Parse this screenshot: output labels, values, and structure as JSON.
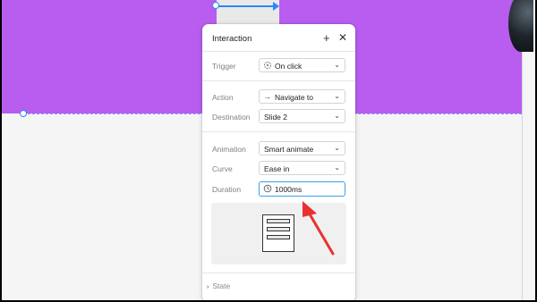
{
  "panel": {
    "title": "Interaction",
    "add_icon": "+",
    "close_icon": "✕"
  },
  "trigger": {
    "label": "Trigger",
    "value": "On click",
    "icon": "tap-icon"
  },
  "action": {
    "label": "Action",
    "value": "Navigate to",
    "icon": "arrow-right-icon"
  },
  "destination": {
    "label": "Destination",
    "value": "Slide 2"
  },
  "animation": {
    "label": "Animation",
    "value": "Smart animate"
  },
  "curve": {
    "label": "Curve",
    "value": "Ease in"
  },
  "duration": {
    "label": "Duration",
    "value": "1000ms",
    "icon": "timer-icon"
  },
  "state": {
    "label": "State"
  },
  "colors": {
    "frame": "#b85df0",
    "selection": "#2d86f5",
    "annotation_arrow": "#e8322f",
    "focus_border": "#3aa0e8"
  }
}
